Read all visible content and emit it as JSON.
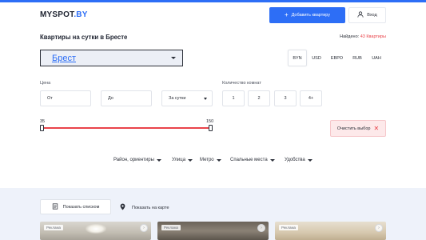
{
  "header": {
    "logo_main": "MYSPOT",
    "logo_suffix": ".BY",
    "add_listing_label": "Добавить квартиру",
    "login_label": "Вход"
  },
  "page": {
    "title": "Квартиры на сутки в Бресте",
    "found_label": "Найдено:",
    "found_count": "43 Квартиры"
  },
  "city_select": {
    "value": "Брест"
  },
  "currencies": [
    "BYN",
    "USD",
    "ЕВРО",
    "RUB",
    "UAH"
  ],
  "currency_selected": "BYN",
  "price": {
    "label": "Цена",
    "from_placeholder": "От",
    "to_placeholder": "До",
    "period_value": "За сутки"
  },
  "rooms": {
    "label": "Количество комнат",
    "options": [
      "1",
      "2",
      "3",
      "4+"
    ]
  },
  "slider": {
    "min": "35",
    "max": "150"
  },
  "clear_label": "Очистить выбор",
  "filters": [
    "Район, ориентиры",
    "Улица",
    "Метро",
    "Спальные места",
    "Удобства"
  ],
  "view": {
    "list_label": "Показать списком",
    "map_label": "Показать на карте"
  },
  "cards": [
    {
      "badge": "Реклама"
    },
    {
      "badge": "Реклама"
    },
    {
      "badge": "Реклама"
    }
  ],
  "colors": {
    "accent": "#2d6ef6",
    "danger": "#e9434a",
    "lower_bg": "#eef2fa"
  }
}
